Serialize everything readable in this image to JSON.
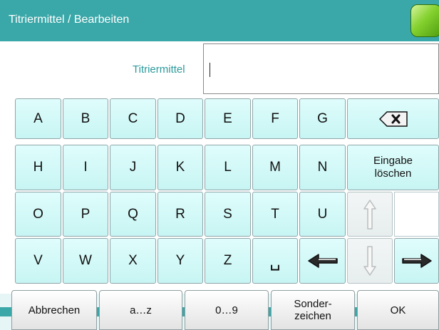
{
  "window": {
    "title": "Titriermittel / Bearbeiten",
    "status_led_color": "#84d12f"
  },
  "input": {
    "label": "Titriermittel",
    "value": ""
  },
  "keyboard": {
    "row1": [
      "A",
      "B",
      "C",
      "D",
      "E",
      "F",
      "G"
    ],
    "row2": [
      "H",
      "I",
      "J",
      "K",
      "L",
      "M",
      "N"
    ],
    "row3": [
      "O",
      "P",
      "Q",
      "R",
      "S",
      "T",
      "U"
    ],
    "row4": [
      "V",
      "W",
      "X",
      "Y",
      "Z",
      "␣"
    ],
    "backspace_icon": "backspace-icon",
    "clear_label_line1": "Eingabe",
    "clear_label_line2": "löschen",
    "up_arrow_icon": "arrow-up-icon",
    "down_arrow_icon": "arrow-down-icon",
    "left_arrow_icon": "arrow-left-icon",
    "right_arrow_icon": "arrow-right-icon"
  },
  "footer": {
    "cancel_label": "Abbrechen",
    "lowercase_label": "a…z",
    "numbers_label": "0…9",
    "special_line1": "Sonder-",
    "special_line2": "zeichen",
    "ok_label": "OK"
  },
  "colors": {
    "accent": "#3aa7a8",
    "label": "#2c9a9c",
    "key_fill": "#d7fbfa"
  }
}
